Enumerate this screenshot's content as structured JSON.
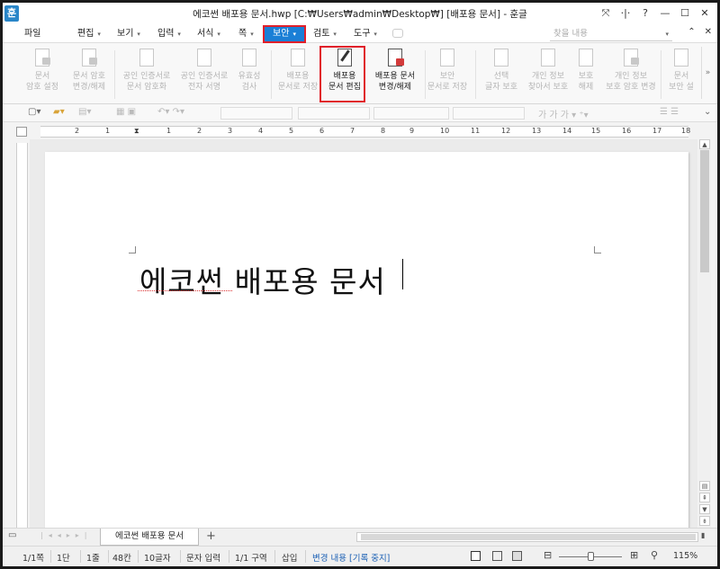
{
  "window": {
    "title": "에코썬 배포용 문서.hwp [C:₩Users₩admin₩Desktop₩] [배포용 문서] - 훈글",
    "logo": "훈",
    "controls": [
      "⤧",
      "·|·",
      "?",
      "—",
      "☐",
      "✕"
    ]
  },
  "menu": {
    "items": [
      {
        "label": "파일",
        "dd": ""
      },
      {
        "label": "편집",
        "dd": "▾"
      },
      {
        "label": "보기",
        "dd": "▾"
      },
      {
        "label": "입력",
        "dd": "▾"
      },
      {
        "label": "서식",
        "dd": "▾"
      },
      {
        "label": "쪽",
        "dd": "▾"
      }
    ],
    "active": {
      "label": "보안",
      "dd": "▾"
    },
    "after": [
      {
        "label": "검토",
        "dd": "▾"
      },
      {
        "label": "도구",
        "dd": "▾"
      }
    ],
    "search_placeholder": "찾을 내용",
    "search_dd": "▾",
    "right_icons": [
      "⌃",
      "✕"
    ]
  },
  "ribbon": {
    "items": [
      {
        "line1": "문서",
        "line2": "암호 설정",
        "enabled": false
      },
      {
        "line1": "문서 암호",
        "line2": "변경/해제",
        "enabled": false
      },
      {
        "line1": "공인 인증서로",
        "line2": "문서 암호화",
        "enabled": false
      },
      {
        "line1": "공인 인증서로",
        "line2": "전자 서명",
        "enabled": false
      },
      {
        "line1": "유효성",
        "line2": "검사",
        "enabled": false
      },
      {
        "line1": "배포용",
        "line2": "문서로 저장",
        "enabled": false
      },
      {
        "line1": "배포용",
        "line2": "문서 편집",
        "enabled": true
      },
      {
        "line1": "배포용 문서",
        "line2": "변경/해제",
        "enabled": true
      },
      {
        "line1": "보안",
        "line2": "문서로 저장",
        "enabled": false
      },
      {
        "line1": "선택",
        "line2": "글자 보호",
        "enabled": false
      },
      {
        "line1": "개인 정보",
        "line2": "찾아서 보호",
        "enabled": false
      },
      {
        "line1": "보호",
        "line2": "해제",
        "enabled": false
      },
      {
        "line1": "개인 정보",
        "line2": "보호 암호 변경",
        "enabled": false
      },
      {
        "line1": "문서",
        "line2": "보안 설",
        "enabled": false
      }
    ],
    "more": "»"
  },
  "ruler": {
    "ticks": [
      "2",
      "1",
      "1",
      "2",
      "3",
      "4",
      "5",
      "6",
      "7",
      "8",
      "9",
      "10",
      "11",
      "12",
      "13",
      "14",
      "15",
      "16",
      "17",
      "18"
    ]
  },
  "document": {
    "text": "에코썬 배포용 문서"
  },
  "tabs": {
    "doc_tab": "에코썬 배포용 문서",
    "add": "+"
  },
  "status": {
    "page": "1/1쪽",
    "section": "1단",
    "line": "1줄",
    "column": "48칸",
    "chars": "10글자",
    "mode": "문자 입력",
    "area": "1/1 구역",
    "insert": "삽입",
    "track": "변경 내용 [기록 중지]",
    "zoom": "115%"
  }
}
